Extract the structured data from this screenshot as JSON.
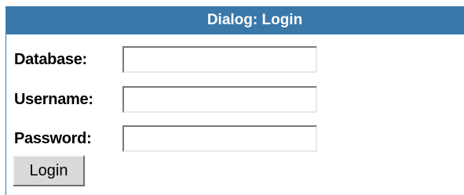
{
  "dialog": {
    "title": "Dialog: Login",
    "title_bar_color": "#3a78aa"
  },
  "form": {
    "database": {
      "label": "Database:",
      "value": ""
    },
    "username": {
      "label": "Username:",
      "value": ""
    },
    "password": {
      "label": "Password:",
      "value": ""
    },
    "login_button_label": "Login"
  }
}
